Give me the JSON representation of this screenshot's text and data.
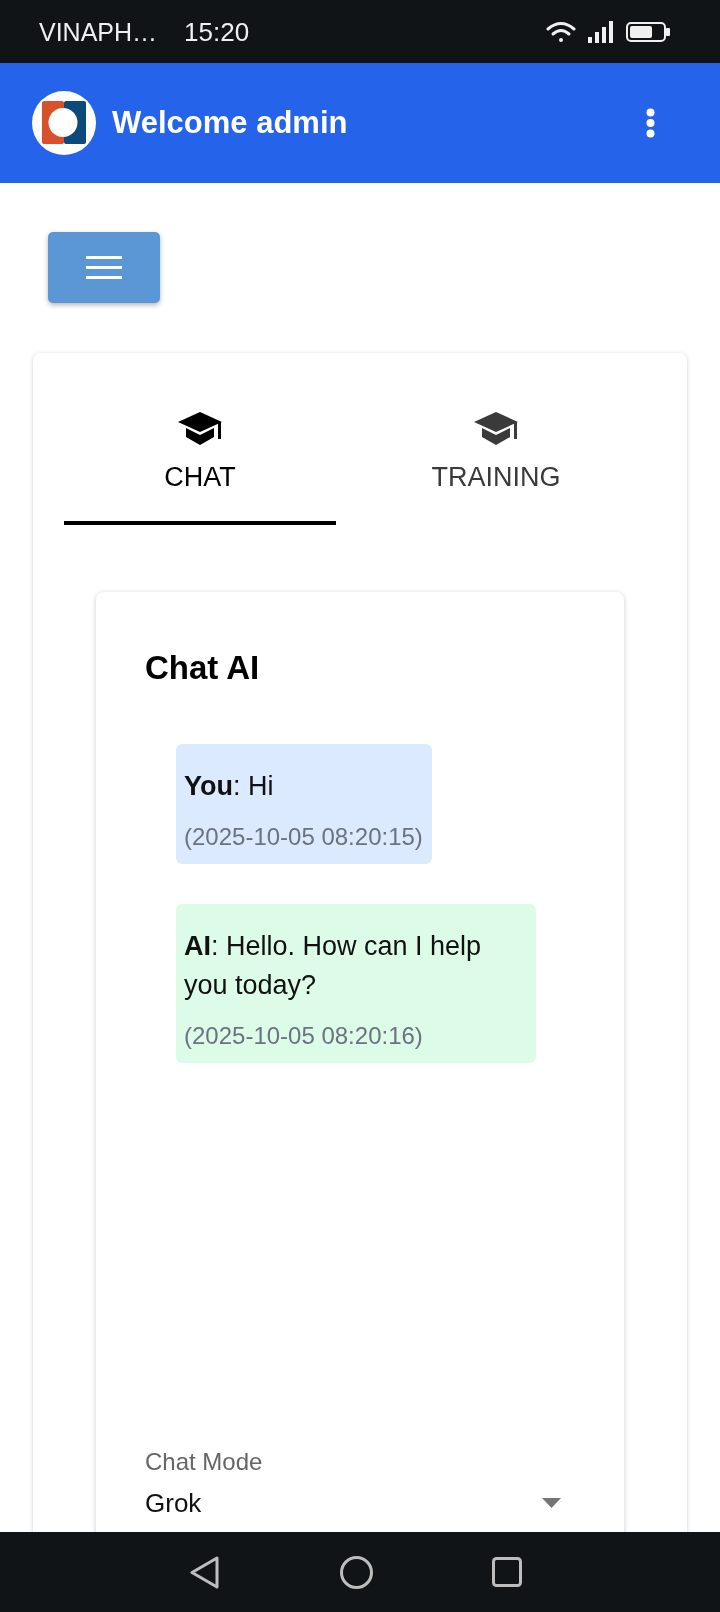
{
  "status_bar": {
    "carrier": "VINAPH…",
    "time": "15:20"
  },
  "header": {
    "title": "Welcome admin"
  },
  "tabs": [
    {
      "label": "CHAT",
      "selected": true
    },
    {
      "label": "TRAINING",
      "selected": false
    }
  ],
  "chat": {
    "title": "Chat AI",
    "messages": [
      {
        "text": "**You**: Hi",
        "time": "(2025-10-05 08:20:15)",
        "color": "#dbeafe"
      },
      {
        "text": "**AI**: Hello. How can I help you today?",
        "time": "(2025-10-05 08:20:16)",
        "color": "#dcfce7"
      }
    ],
    "mode_select": {
      "label": "Chat Mode",
      "value": "Grok"
    }
  }
}
